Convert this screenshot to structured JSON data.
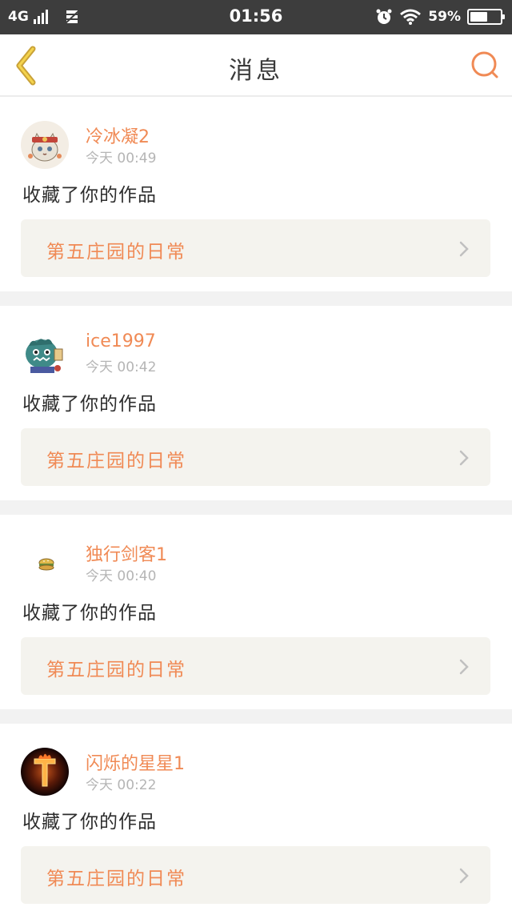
{
  "status_bar": {
    "network": "4G",
    "time": "01:56",
    "battery_percent": "59%",
    "battery_level": 0.59
  },
  "header": {
    "title": "消息",
    "back_icon": "chevron-left-icon",
    "search_icon": "search-icon"
  },
  "colors": {
    "accent": "#f08a55",
    "back_arrow": "#c9a238",
    "status_bar_bg": "#3d3d3d",
    "card_link_bg": "#f4f3ee"
  },
  "messages": [
    {
      "username": "冷冰凝2",
      "time": "今天 00:49",
      "action": "收藏了你的作品",
      "work_title": "第五庄园的日常",
      "avatar_icon": "cat-avatar-icon"
    },
    {
      "username": "ice1997",
      "time": "今天 00:42",
      "action": "收藏了你的作品",
      "work_title": "第五庄园的日常",
      "avatar_icon": "monster-avatar-icon"
    },
    {
      "username": "独行剑客1",
      "time": "今天 00:40",
      "action": "收藏了你的作品",
      "work_title": "第五庄园的日常",
      "avatar_icon": "burger-avatar-icon"
    },
    {
      "username": "闪烁的星星1",
      "time": "今天 00:22",
      "action": "收藏了你的作品",
      "work_title": "第五庄园的日常",
      "avatar_icon": "fire-avatar-icon"
    }
  ]
}
